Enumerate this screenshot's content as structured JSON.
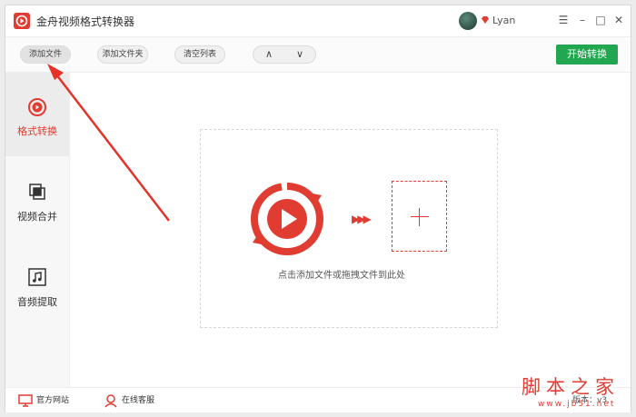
{
  "app": {
    "title": "金舟视频格式转换器",
    "brand_color": "#e03c31",
    "accent_green": "#21a74f"
  },
  "user": {
    "name": "Lyan"
  },
  "window_controls": {
    "menu": "☰",
    "minimize": "–",
    "maximize": "□",
    "close": "✕"
  },
  "toolbar": {
    "add_file": "添加文件",
    "add_folder": "添加文件夹",
    "clear_list": "清空列表",
    "move_up": "∧",
    "move_down": "∨",
    "start_convert": "开始转换"
  },
  "sidebar": {
    "items": [
      {
        "label": "格式转换",
        "icon": "play-circle-icon",
        "active": true
      },
      {
        "label": "视频合并",
        "icon": "merge-squares-icon",
        "active": false
      },
      {
        "label": "音频提取",
        "icon": "music-note-icon",
        "active": false
      }
    ]
  },
  "dropzone": {
    "hint": "点击添加文件或拖拽文件到此处"
  },
  "footer": {
    "official_site": "官方网站",
    "online_service": "在线客服",
    "version": "版本：v3."
  },
  "watermark": {
    "main": "脚本之家",
    "sub": "www.jb51.net"
  }
}
